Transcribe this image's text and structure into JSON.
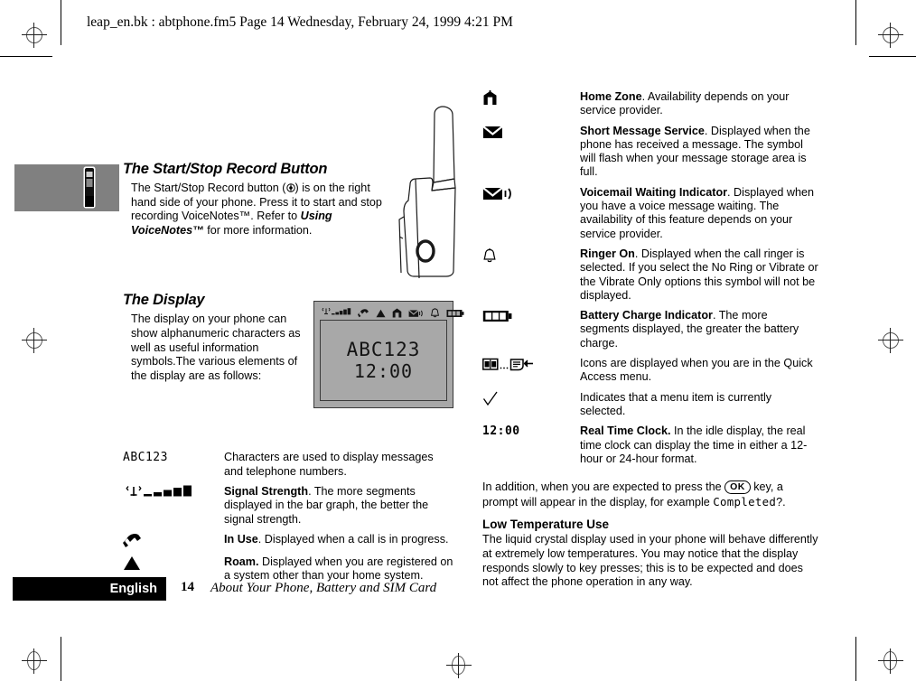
{
  "header": {
    "text": "leap_en.bk : abtphone.fm5  Page 14  Wednesday, February 24, 1999  4:21 PM"
  },
  "left_column": {
    "record_button": {
      "heading": "The Start/Stop Record Button",
      "para_part1": "The Start/Stop Record button (",
      "para_part2": ") is on the right hand side of your phone. Press it to start and stop recording VoiceNotes™. Refer to ",
      "emphasis": "Using VoiceNotes™",
      "para_part3": " for more information."
    },
    "display": {
      "heading": "The Display",
      "paragraph": "The display on your phone can show alphanumeric characters as well as useful information symbols.The various elements of the display are as follows:"
    },
    "lcd": {
      "line1": "ABC123",
      "line2": "12:00",
      "icons": [
        "signal-strength-icon",
        "in-use-icon",
        "roam-icon",
        "home-zone-icon",
        "voicemail-icon",
        "ringer-icon",
        "battery-icon"
      ]
    },
    "legend": [
      {
        "symbol": "ABC123",
        "symbol_kind": "lcd-text",
        "bold": "",
        "text": "Characters are used to display messages and telephone numbers."
      },
      {
        "symbol": "signal-strength-icon",
        "symbol_kind": "icon",
        "bold": "Signal Strength",
        "text": ". The more segments displayed in the bar graph, the better the signal strength."
      },
      {
        "symbol": "in-use-icon",
        "symbol_kind": "icon",
        "bold": "In Use",
        "text": ". Displayed when a call is in progress."
      },
      {
        "symbol": "roam-icon",
        "symbol_kind": "icon",
        "bold": "Roam.",
        "text": " Displayed when you are registered on a system other than your home system."
      }
    ]
  },
  "right_column": {
    "legend": [
      {
        "symbol": "home-zone-icon",
        "bold": "Home Zone",
        "text": ". Availability depends on your service provider."
      },
      {
        "symbol": "envelope-icon",
        "bold": "Short Message Service",
        "text": ". Displayed when the phone has received a message. The symbol will flash when your message storage area is full."
      },
      {
        "symbol": "voicemail-icon",
        "bold": "Voicemail Waiting Indicator",
        "text": ". Displayed when you have a voice message waiting. The availability of this feature depends on your service provider."
      },
      {
        "symbol": "ringer-bell-icon",
        "bold": "Ringer On",
        "text": ". Displayed when the call ringer is selected. If you select the No Ring or Vibrate or the Vibrate Only options this symbol will not be displayed."
      },
      {
        "symbol": "battery-icon",
        "bold": "Battery Charge Indicator",
        "text": ". The more segments displayed, the greater the battery charge."
      },
      {
        "symbol": "quick-access-icons",
        "bold": "",
        "text": "Icons are displayed when you are in the Quick Access menu."
      },
      {
        "symbol": "checkmark-icon",
        "bold": "",
        "text": "Indicates that a menu item is currently selected."
      },
      {
        "symbol": "12:00",
        "bold": "Real Time Clock.",
        "text": " In the idle display, the real time clock can display the time in either a 12-hour or 24-hour format."
      }
    ],
    "ok_paragraph": {
      "part1": "In addition, when you are expected to press the ",
      "key_label": "OK",
      "part2": " key, a prompt will appear in the display, for example ",
      "lcd_word": "Completed",
      "part3": "?."
    },
    "low_temp": {
      "heading": "Low Temperature Use",
      "paragraph": "The liquid crystal display used in your phone will behave differently at extremely low temperatures. You may notice that the display responds slowly to key presses; this is to be expected and does not affect the phone operation in any way."
    }
  },
  "footer": {
    "language": "English",
    "page_number": "14",
    "section_title": "About Your Phone, Battery and SIM Card"
  }
}
